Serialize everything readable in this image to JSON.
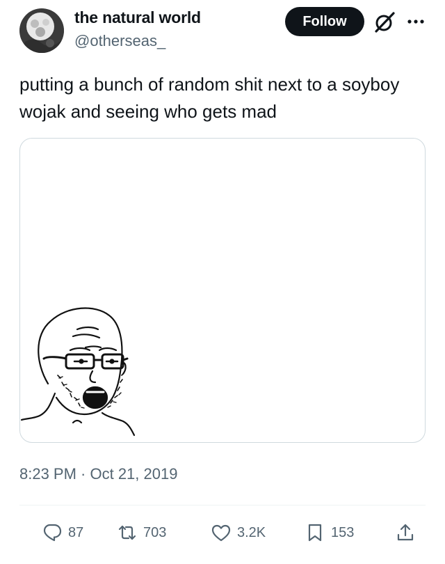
{
  "author": {
    "display_name": "the natural world",
    "handle": "@otherseas_"
  },
  "header": {
    "follow_label": "Follow",
    "grok_icon": "grok-icon",
    "more_icon": "more-icon"
  },
  "tweet": {
    "text": "putting a bunch of random shit next to a soyboy wojak and seeing who gets mad",
    "timestamp": "8:23 PM · Oct 21, 2019",
    "media": {
      "description_icon": "soyboy-wojak-drawing"
    }
  },
  "actions": {
    "replies": "87",
    "retweets": "703",
    "likes": "3.2K",
    "bookmarks": "153",
    "share_icon": "share-icon"
  },
  "colors": {
    "text": "#0f1419",
    "secondary": "#536471",
    "border": "#cfd9de",
    "button_bg": "#0f1419"
  }
}
